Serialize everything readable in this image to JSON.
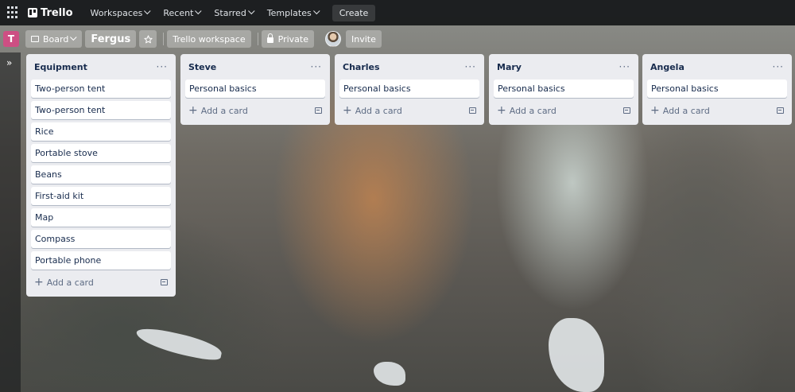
{
  "topbar": {
    "logo": "Trello",
    "nav": [
      {
        "label": "Workspaces"
      },
      {
        "label": "Recent"
      },
      {
        "label": "Starred"
      },
      {
        "label": "Templates"
      }
    ],
    "create_label": "Create"
  },
  "board_header": {
    "workspace_initial": "T",
    "view_label": "Board",
    "board_title": "Fergus",
    "workspace_label": "Trello workspace",
    "visibility_label": "Private",
    "invite_label": "Invite"
  },
  "lists": [
    {
      "title": "Equipment",
      "cards": [
        "Two-person tent",
        "Two-person tent",
        "Rice",
        "Portable stove",
        "Beans",
        "First-aid kit",
        "Map",
        "Compass",
        "Portable phone"
      ],
      "add_label": "Add a card"
    },
    {
      "title": "Steve",
      "cards": [
        "Personal basics"
      ],
      "add_label": "Add a card"
    },
    {
      "title": "Charles",
      "cards": [
        "Personal basics"
      ],
      "add_label": "Add a card"
    },
    {
      "title": "Mary",
      "cards": [
        "Personal basics"
      ],
      "add_label": "Add a card"
    },
    {
      "title": "Angela",
      "cards": [
        "Personal basics"
      ],
      "add_label": "Add a card"
    }
  ],
  "colors": {
    "topbar_bg": "#141618",
    "workspace_avatar": "#cd4f83",
    "list_bg": "#ebecf0"
  }
}
